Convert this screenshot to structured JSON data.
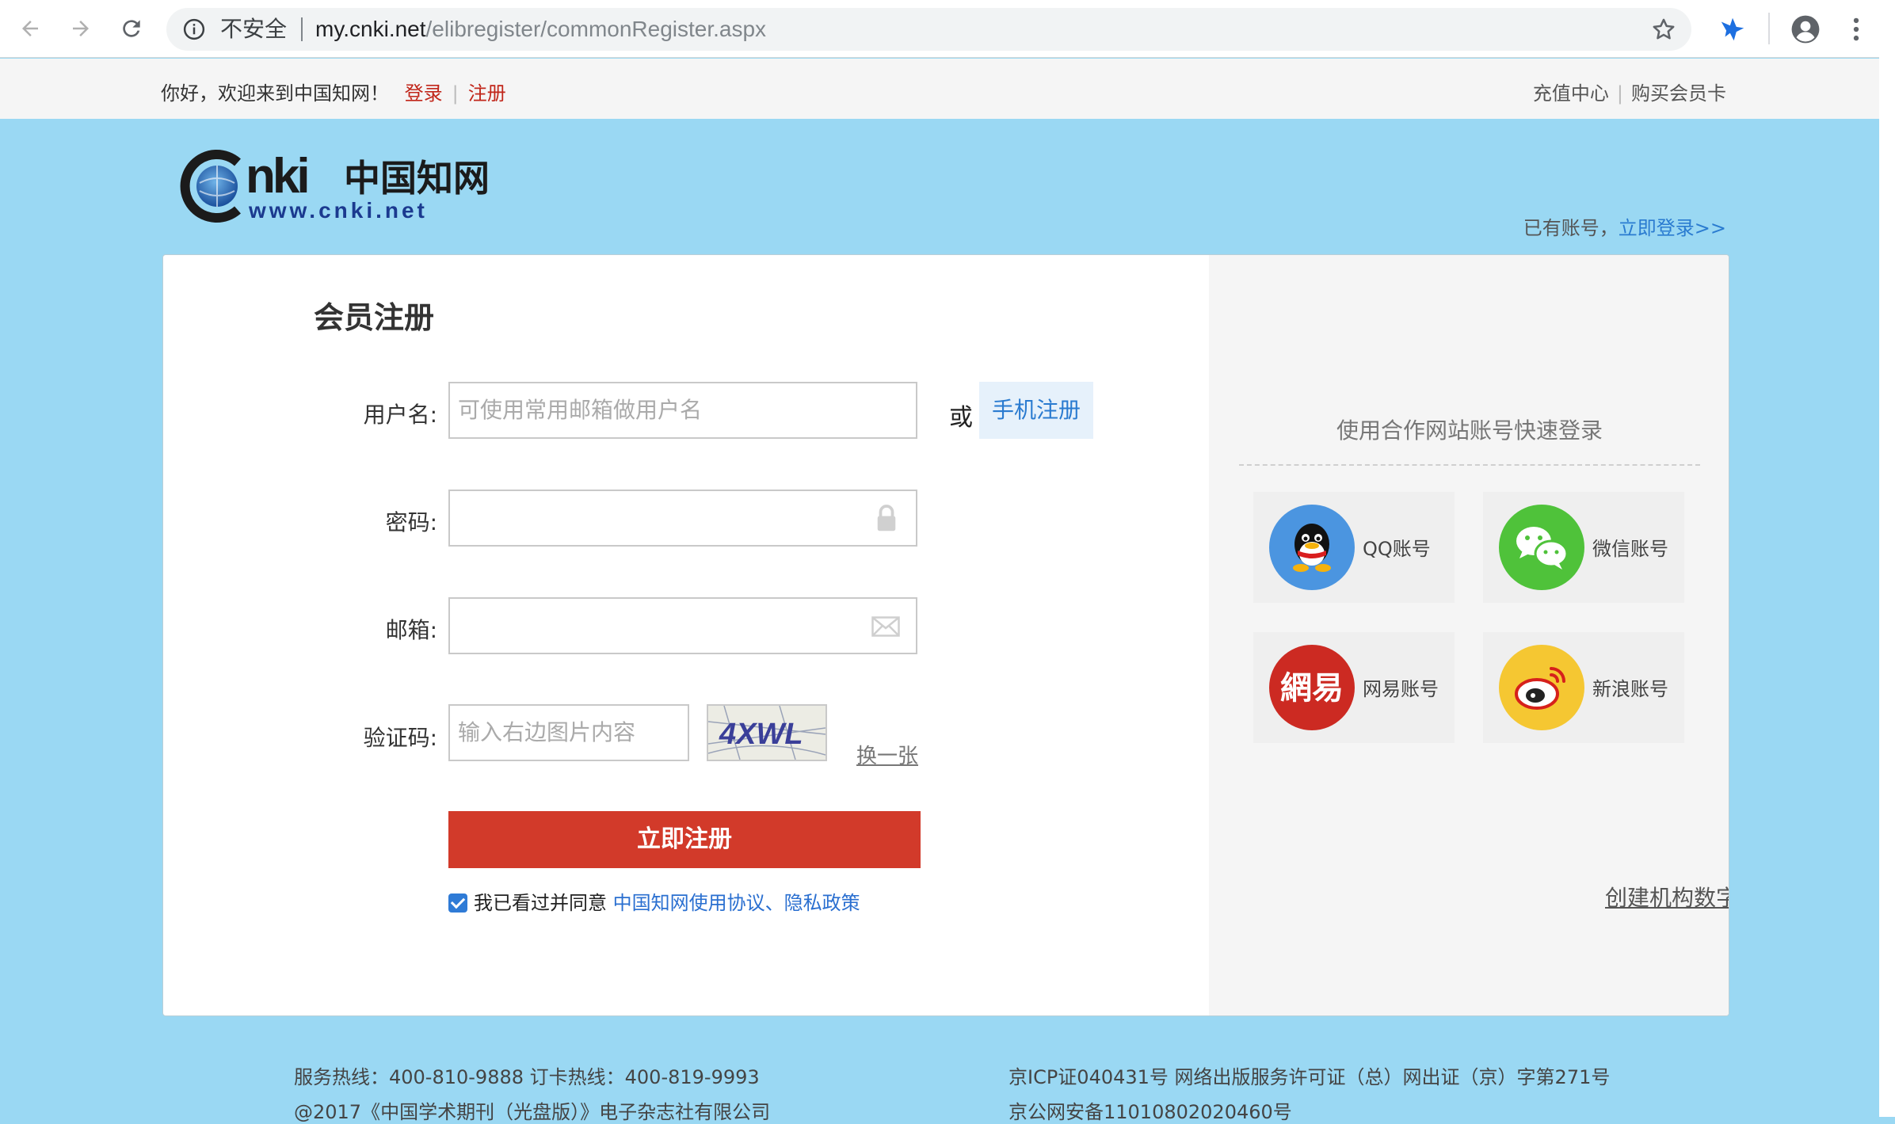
{
  "browser": {
    "security_label": "不安全",
    "url_host": "my.cnki.net",
    "url_path": "/elibregister/commonRegister.aspx"
  },
  "topnav": {
    "welcome": "你好，欢迎来到中国知网！",
    "login": "登录",
    "register": "注册",
    "recharge": "充值中心",
    "buy_card": "购买会员卡"
  },
  "logo": {
    "chinese": "中国知网",
    "url": "www.cnki.net",
    "mark": "CNKI"
  },
  "login_hint": {
    "text": "已有账号，",
    "link": "立即登录>>"
  },
  "form": {
    "title": "会员注册",
    "username_label": "用户名:",
    "username_placeholder": "可使用常用邮箱做用户名",
    "or": "或",
    "phone_register": "手机注册",
    "password_label": "密码:",
    "email_label": "邮箱:",
    "captcha_label": "验证码:",
    "captcha_placeholder": "输入右边图片内容",
    "captcha_text": "4XWL",
    "captcha_refresh": "换一张",
    "submit": "立即注册",
    "agree_text": "我已看过并同意",
    "agree_link": "中国知网使用协议、隐私政策"
  },
  "partners": {
    "title": "使用合作网站账号快速登录",
    "items": [
      {
        "label": "QQ账号",
        "icon": "qq-icon",
        "color": "#4b95e0"
      },
      {
        "label": "微信账号",
        "icon": "wechat-icon",
        "color": "#4fc23a"
      },
      {
        "label": "网易账号",
        "icon": "netease-icon",
        "color": "#cc2a22"
      },
      {
        "label": "新浪账号",
        "icon": "weibo-icon",
        "color": "#f5c732"
      }
    ],
    "create_library": "创建机构数字图书馆 >>"
  },
  "footer": {
    "hotline": "服务热线：400-810-9888  订卡热线：400-819-9993",
    "copyright": "@2017《中国学术期刊（光盘版）》电子杂志社有限公司",
    "icp": "京ICP证040431号 网络出版服务许可证（总）网出证（京）字第271号",
    "police": "京公网安备11010802020460号"
  },
  "colors": {
    "page_bg": "#9ad8f3",
    "accent_red": "#d23a2a",
    "link_blue": "#2a7bd0"
  }
}
